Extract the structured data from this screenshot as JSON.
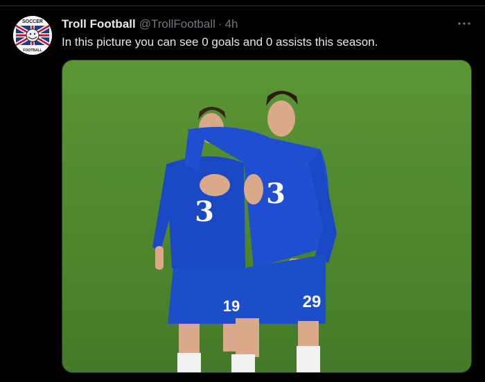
{
  "tweet": {
    "author_name": "Troll Football",
    "handle": "@TrollFootball",
    "separator": "·",
    "time": "4h",
    "text": "In this picture you can see 0 goals and 0 assists this season.",
    "avatar_text_top": "SOCCER",
    "avatar_text_bottom": "FOOTBALL",
    "more_icon": "more-horizontal-icon"
  },
  "media": {
    "player_left_number": "19",
    "player_right_number": "29",
    "sponsor_glyph": "3",
    "colors": {
      "pitch": "#4f8a2f",
      "kit": "#1a47c4",
      "shorts": "#1c4ec9"
    }
  }
}
